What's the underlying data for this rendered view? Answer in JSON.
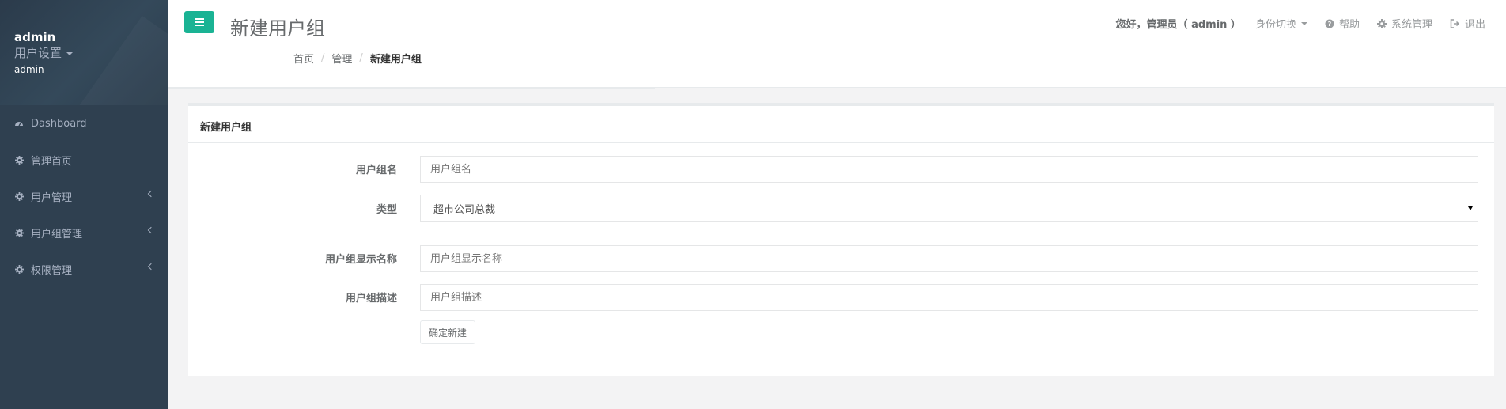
{
  "sidebar": {
    "user_name": "admin",
    "settings_label": "用户设置",
    "role": "admin",
    "items": [
      {
        "label": "Dashboard"
      },
      {
        "label": "管理首页"
      },
      {
        "label": "用户管理"
      },
      {
        "label": "用户组管理"
      },
      {
        "label": "权限管理"
      }
    ]
  },
  "header": {
    "title": "新建用户组",
    "breadcrumb": [
      "首页",
      "管理",
      "新建用户组"
    ],
    "separator": "/",
    "welcome": "您好，管理员（ admin ）",
    "switch_identity": "身份切换",
    "help": "帮助",
    "system_admin": "系统管理",
    "logout": "退出"
  },
  "form": {
    "panel_title": "新建用户组",
    "group_name_label": "用户组名",
    "group_name_placeholder": "用户组名",
    "type_label": "类型",
    "type_value": "超市公司总裁",
    "display_name_label": "用户组显示名称",
    "display_name_placeholder": "用户组显示名称",
    "description_label": "用户组描述",
    "description_placeholder": "用户组描述",
    "submit_label": "确定新建"
  },
  "colors": {
    "sidebar_bg": "#2f4050",
    "accent": "#1ab394"
  }
}
